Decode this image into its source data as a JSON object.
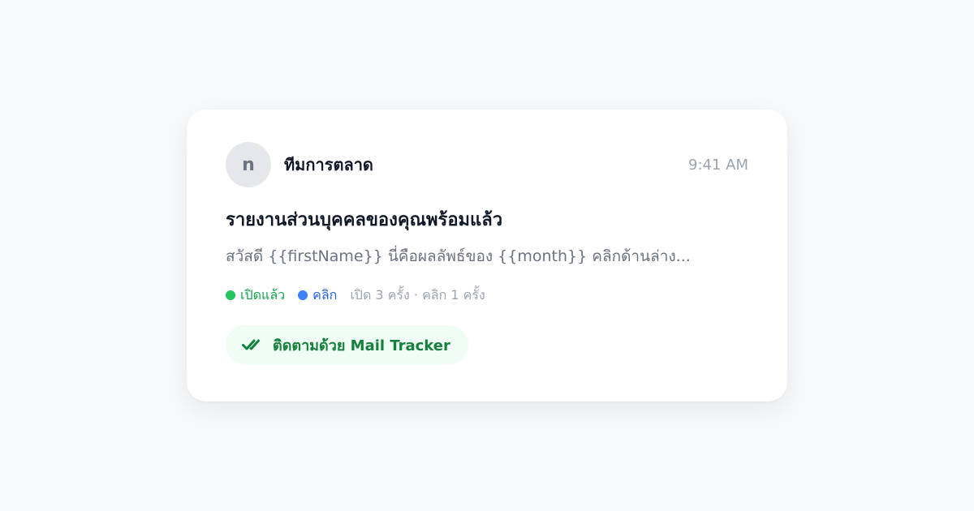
{
  "email": {
    "sender_initial": "n",
    "sender_name": "ทีมการตลาด",
    "time": "9:41 AM",
    "subject": "รายงานส่วนบุคคลของคุณพร้อมแล้ว",
    "preview": "สวัสดี {{firstName}} นี่คือผลลัพธ์ของ {{month}} คลิกด้านล่าง..."
  },
  "status": {
    "opened_label": "เปิดแล้ว",
    "clicked_label": "คลิก",
    "stats_text": "เปิด 3 ครั้ง · คลิก 1 ครั้ง"
  },
  "badge": {
    "label": "ติดตามด้วย Mail Tracker",
    "icon": "double-check-icon"
  },
  "colors": {
    "opened": "#22c55e",
    "clicked": "#3b82f6",
    "badge_bg": "#f0fdf4",
    "badge_text": "#15803d"
  }
}
